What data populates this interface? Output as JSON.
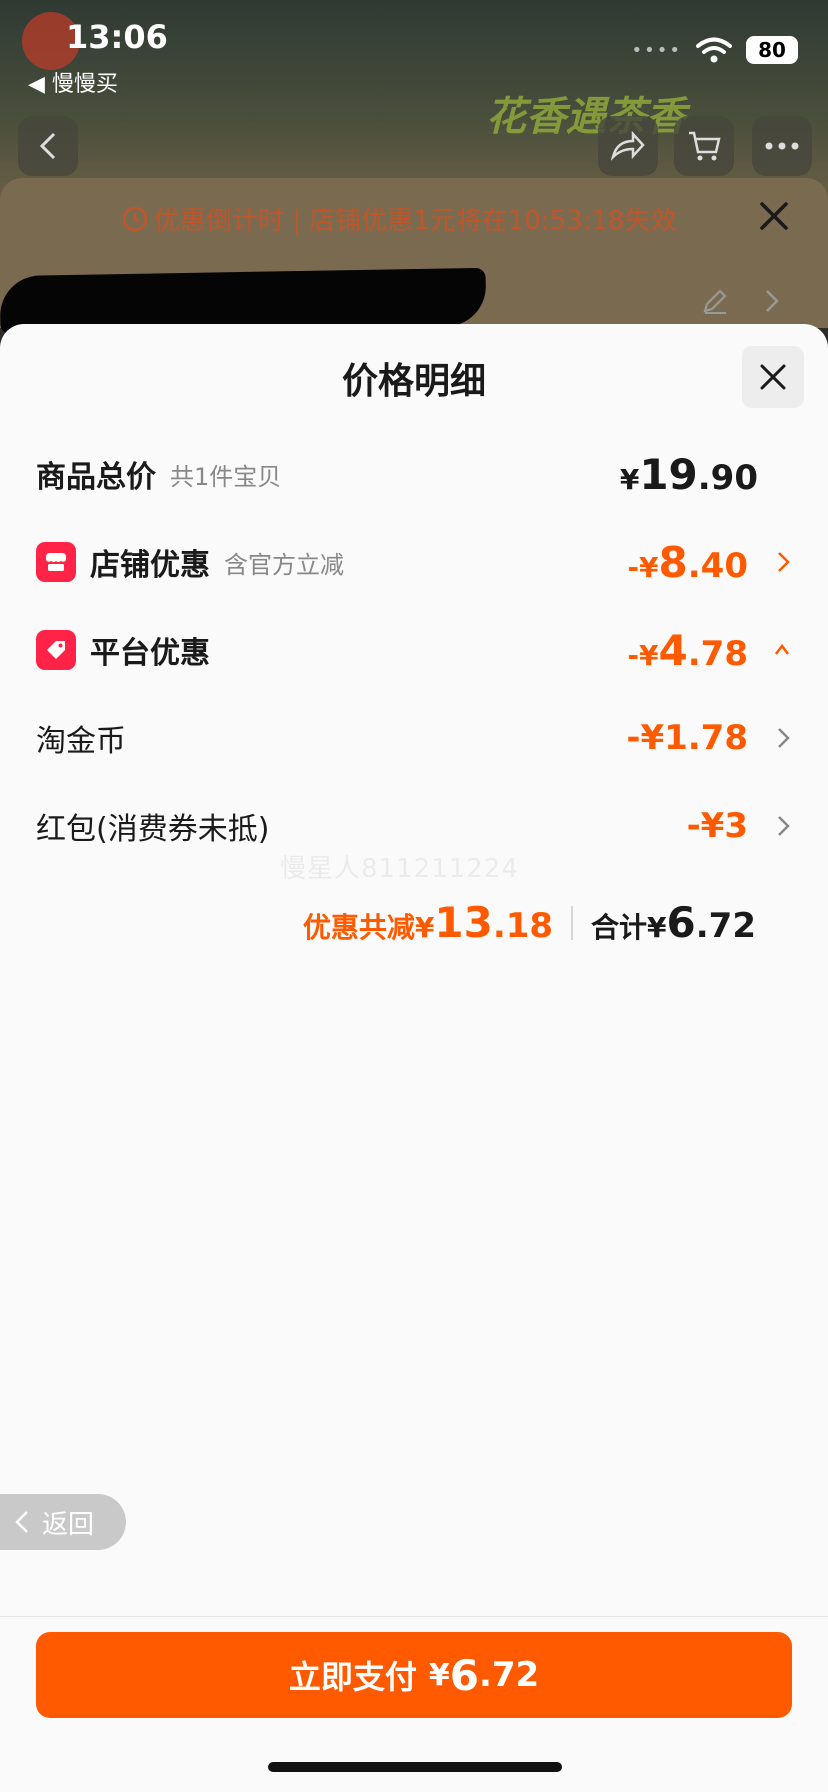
{
  "status_bar": {
    "time": "13:06",
    "back_app": "◀ 慢慢买",
    "battery": "80"
  },
  "background": {
    "banner": "花香遇茶香",
    "countdown": "优惠倒计时 | 店铺优惠1元将在10:53:18失效"
  },
  "sheet": {
    "title": "价格明细",
    "rows": [
      {
        "label": "商品总价",
        "sub": "共1件宝贝",
        "cur": "¥",
        "int": "19",
        "dec": ".90"
      },
      {
        "label": "店铺优惠",
        "sub": "含官方立减",
        "cur": "-¥",
        "int": "8",
        "dec": ".40"
      },
      {
        "label": "平台优惠",
        "sub": "",
        "cur": "-¥",
        "int": "4",
        "dec": ".78"
      },
      {
        "label": "淘金币",
        "value": "-¥1.78"
      },
      {
        "label": "红包(消费券未抵)",
        "value": "-¥3"
      }
    ],
    "watermark": "慢星人811211224",
    "summary": {
      "discount_label": "优惠共减¥",
      "discount_int": "13",
      "discount_dec": ".18",
      "total_label": "合计¥",
      "total_int": "6",
      "total_dec": ".72"
    }
  },
  "back_button": "返回",
  "pay_button": {
    "label": "立即支付",
    "cur": "¥",
    "int": "6",
    "dec": ".72"
  },
  "colors": {
    "accent": "#ff5a00",
    "badge": "#ff2447"
  },
  "icons": [
    "clock-icon",
    "close-icon",
    "shop-icon",
    "tag-icon",
    "chevron-right-icon",
    "chevron-up-icon",
    "chevron-left-icon",
    "wifi-icon",
    "edit-icon",
    "share-icon",
    "cart-icon",
    "more-icon"
  ]
}
